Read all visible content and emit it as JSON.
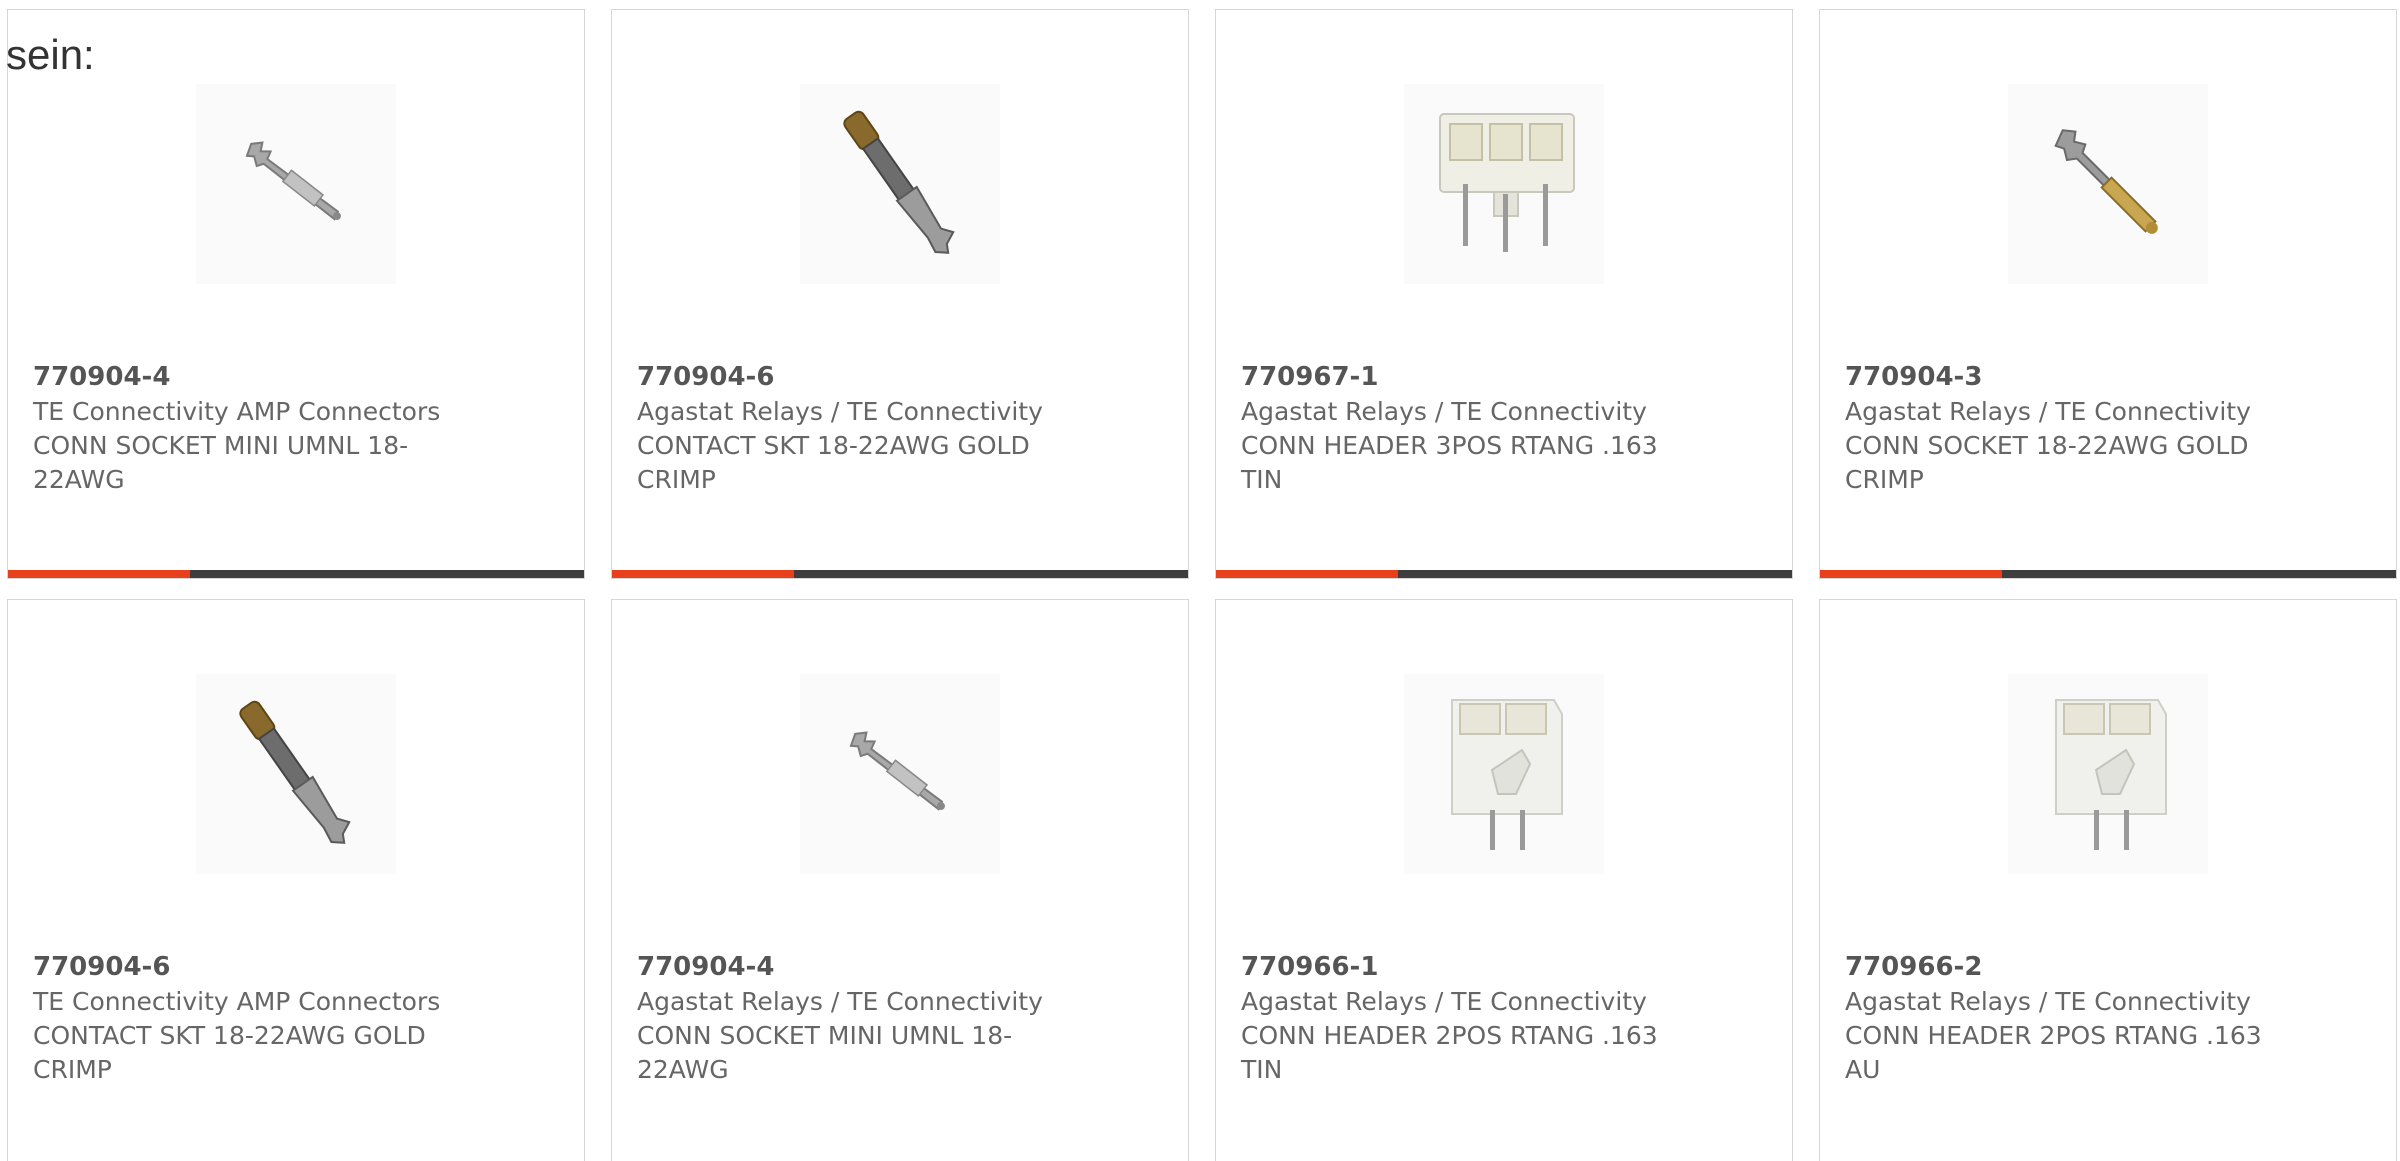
{
  "intro_text": "sein:",
  "colors": {
    "accent": "#e8401c",
    "bar_dark": "#3d3d3d",
    "card_border": "#d6d6d6"
  },
  "products": [
    {
      "part_number": "770904-4",
      "manufacturer": "TE Connectivity AMP Connectors",
      "description": "CONN SOCKET MINI UMNL 18-\n22AWG",
      "image": "silver-crimp-contact-icon"
    },
    {
      "part_number": "770904-6",
      "manufacturer": "Agastat Relays / TE Connectivity",
      "description": "CONTACT SKT 18-22AWG GOLD\nCRIMP",
      "image": "gold-crimp-contact-icon"
    },
    {
      "part_number": "770967-1",
      "manufacturer": "Agastat Relays / TE Connectivity",
      "description": "CONN HEADER 3POS RTANG .163\nTIN",
      "image": "3pos-header-icon"
    },
    {
      "part_number": "770904-3",
      "manufacturer": "Agastat Relays / TE Connectivity",
      "description": "CONN SOCKET 18-22AWG GOLD\nCRIMP",
      "image": "gold-pin-contact-icon"
    },
    {
      "part_number": "770904-6",
      "manufacturer": "TE Connectivity AMP Connectors",
      "description": "CONTACT SKT 18-22AWG GOLD\nCRIMP",
      "image": "gold-crimp-contact-icon"
    },
    {
      "part_number": "770904-4",
      "manufacturer": "Agastat Relays / TE Connectivity",
      "description": "CONN SOCKET MINI UMNL 18-\n22AWG",
      "image": "silver-crimp-contact-icon"
    },
    {
      "part_number": "770966-1",
      "manufacturer": "Agastat Relays / TE Connectivity",
      "description": "CONN HEADER 2POS RTANG .163\nTIN",
      "image": "2pos-header-icon"
    },
    {
      "part_number": "770966-2",
      "manufacturer": "Agastat Relays / TE Connectivity",
      "description": "CONN HEADER 2POS RTANG .163\nAU",
      "image": "2pos-header-icon"
    }
  ]
}
